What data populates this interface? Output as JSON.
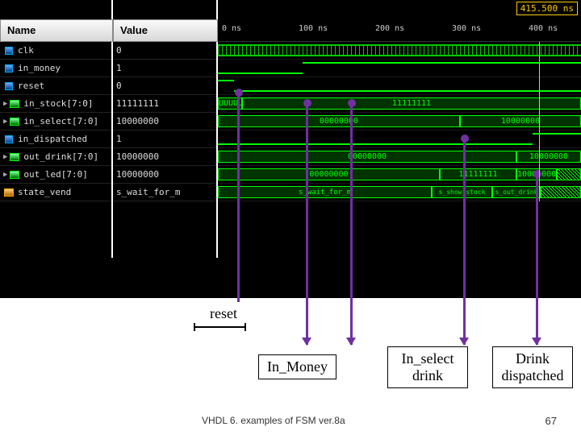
{
  "cursor_time": "415.500 ns",
  "headers": {
    "name": "Name",
    "value": "Value"
  },
  "time_ticks": [
    "0 ns",
    "100 ns",
    "200 ns",
    "300 ns",
    "400 ns"
  ],
  "signals": [
    {
      "name": "clk",
      "value": "0",
      "type": "bit"
    },
    {
      "name": "in_money",
      "value": "1",
      "type": "bit"
    },
    {
      "name": "reset",
      "value": "0",
      "type": "bit"
    },
    {
      "name": "in_stock[7:0]",
      "value": "11111111",
      "type": "bus"
    },
    {
      "name": "in_select[7:0]",
      "value": "10000000",
      "type": "bus"
    },
    {
      "name": "in_dispatched",
      "value": "1",
      "type": "bit"
    },
    {
      "name": "out_drink[7:0]",
      "value": "10000000",
      "type": "bus"
    },
    {
      "name": "out_led[7:0]",
      "value": "10000000",
      "type": "bus"
    },
    {
      "name": "state_vend",
      "value": "s_wait_for_m",
      "type": "state"
    }
  ],
  "bus_values": {
    "in_stock": [
      "UUUUUUUU",
      "11111111"
    ],
    "in_select": [
      "00000000",
      "10000000"
    ],
    "out_drink": [
      "00000000",
      "10000000"
    ],
    "out_led_seq": [
      "00000000",
      "11111111",
      "10000000"
    ],
    "state_seq": [
      "s_wait_for_m",
      "s_show_stock",
      "s_out_drink"
    ]
  },
  "annotations": {
    "reset": "reset",
    "in_money": "In_Money",
    "in_select": "In_select drink",
    "drink": "Drink dispatched"
  },
  "footer": "VHDL 6. examples of FSM ver.8a",
  "page": "67"
}
